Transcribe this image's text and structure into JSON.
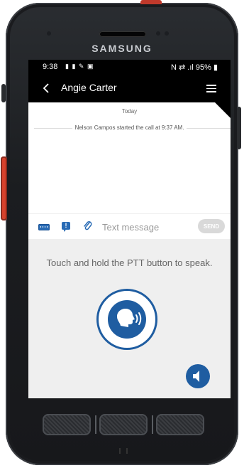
{
  "device": {
    "brand": "SAMSUNG"
  },
  "status_bar": {
    "time": "9:38",
    "left_icons": "▮ ▮ ✎ ▣",
    "right": "N  ⇄ .ıl 95% ▮"
  },
  "app_bar": {
    "title": "Angie Carter"
  },
  "chat": {
    "date_separator": "Today",
    "system_message": "Nelson Campos started the call at 9:37 AM."
  },
  "composer": {
    "placeholder": "Text message",
    "send_label": "SEND"
  },
  "ptt": {
    "hint": "Touch and hold the PTT button to speak."
  },
  "colors": {
    "accent": "#1f5da1",
    "ptt_background": "#efefef",
    "send_disabled": "#d9d9d9"
  },
  "icons": [
    "back-arrow-icon",
    "menu-icon",
    "keyboard-icon",
    "alert-icon",
    "paperclip-icon",
    "speaking-head-icon",
    "speaker-icon"
  ]
}
